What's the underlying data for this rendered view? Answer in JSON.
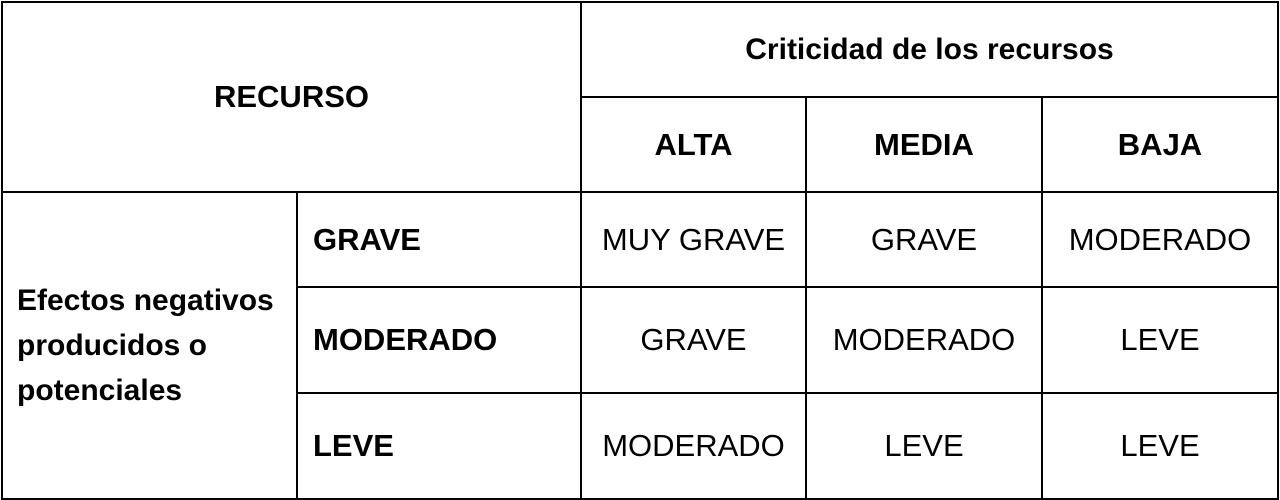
{
  "table": {
    "corner_header": "RECURSO",
    "group_header": "Criticidad de los recursos",
    "columns": [
      "ALTA",
      "MEDIA",
      "BAJA"
    ],
    "row_group_label": "Efectos negativos producidos o potenciales",
    "rows": [
      {
        "label": "GRAVE",
        "cells": [
          "MUY GRAVE",
          "GRAVE",
          "MODERADO"
        ]
      },
      {
        "label": "MODERADO",
        "cells": [
          "GRAVE",
          "MODERADO",
          "LEVE"
        ]
      },
      {
        "label": "LEVE",
        "cells": [
          "MODERADO",
          "LEVE",
          "LEVE"
        ]
      }
    ]
  }
}
